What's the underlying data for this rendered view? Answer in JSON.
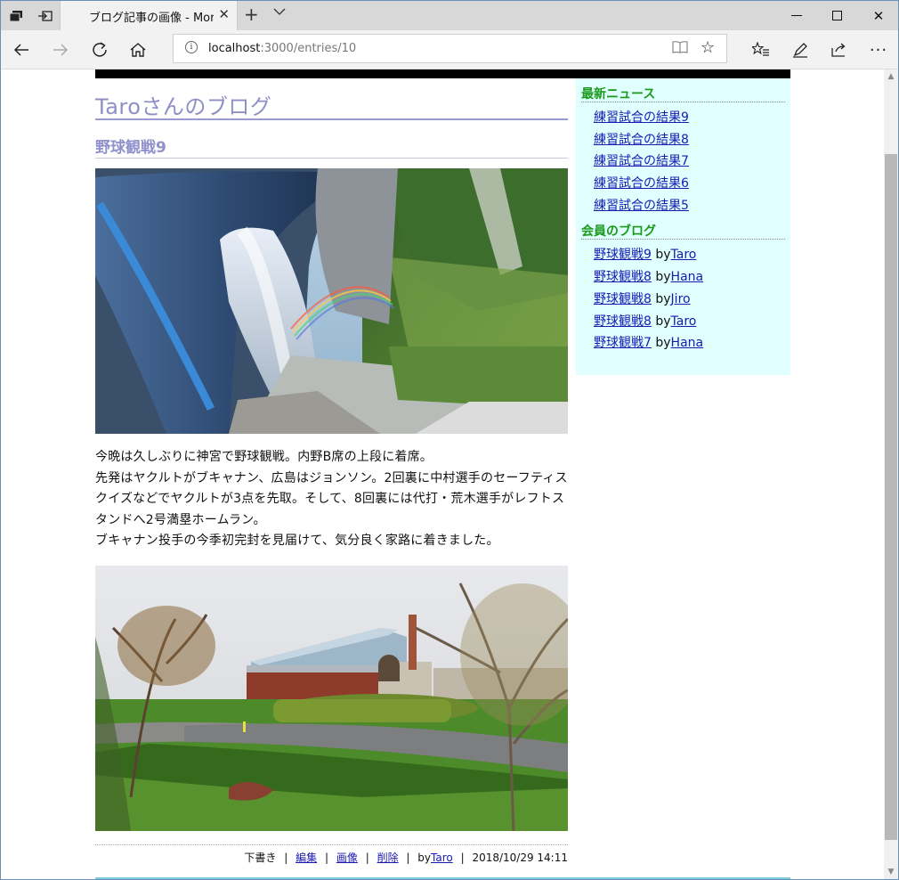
{
  "browser": {
    "tab_title": "ブログ記事の画像 - Morn",
    "url_host": "localhost",
    "url_path": ":3000/entries/10"
  },
  "blog": {
    "title": "Taroさんのブログ",
    "entry_title": "野球観戦9",
    "body": [
      "今晩は久しぶりに神宮で野球観戦。内野B席の上段に着席。",
      "先発はヤクルトがブキャナン、広島はジョンソン。2回裏に中村選手のセーフティスクイズなどでヤクルトが3点を先取。そして、8回裏には代打・荒木選手がレフトスタンドへ2号満塁ホームラン。",
      "ブキャナン投手の今季初完封を見届けて、気分良く家路に着きました。"
    ],
    "footer": {
      "status": "下書き",
      "edit": "編集",
      "images": "画像",
      "delete": "削除",
      "by": "by",
      "author": "Taro",
      "datetime": "2018/10/29 14:11"
    }
  },
  "sidebar": {
    "news_heading": "最新ニュース",
    "news": [
      "練習試合の結果9",
      "練習試合の結果8",
      "練習試合の結果7",
      "練習試合の結果6",
      "練習試合の結果5"
    ],
    "blogs_heading": "会員のブログ",
    "by": "by",
    "blogs": [
      {
        "title": "野球観戦9",
        "author": "Taro"
      },
      {
        "title": "野球観戦8",
        "author": "Hana"
      },
      {
        "title": "野球観戦8",
        "author": "Jiro"
      },
      {
        "title": "野球観戦8",
        "author": "Taro"
      },
      {
        "title": "野球観戦7",
        "author": "Hana"
      }
    ]
  },
  "colors": {
    "blog_title": "#8f8fc8",
    "sidebar_bg": "#e0ffff",
    "sidebar_heading": "#1a9a1a",
    "link": "#1a1ab0"
  }
}
